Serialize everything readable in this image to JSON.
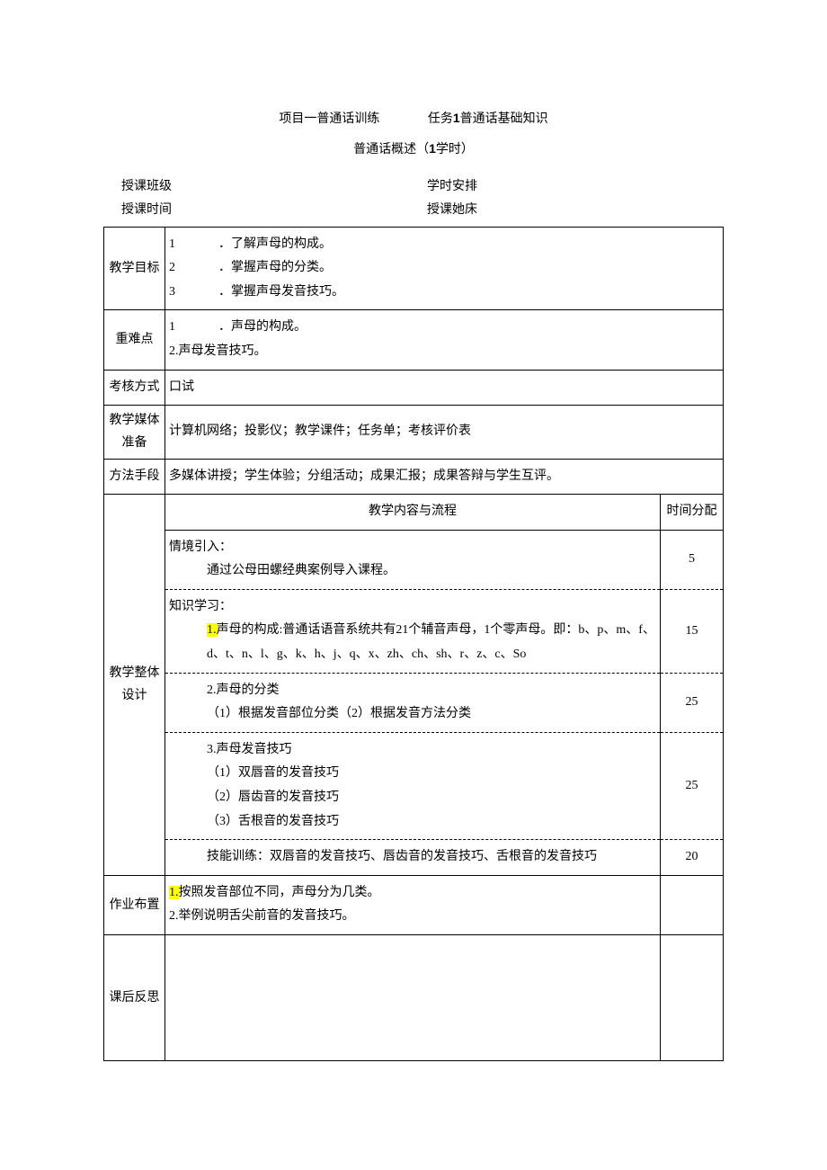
{
  "title": {
    "project": "项目一普通话训练",
    "task": "任务",
    "task_num": "1",
    "task_name": "普通话基础知识",
    "subtitle_pre": "普通话概述（",
    "subtitle_num": "1",
    "subtitle_post": "学时）"
  },
  "header": {
    "class_label": "授课班级",
    "class_value": "",
    "schedule_label": "学时安排",
    "schedule_value": "",
    "time_label": "授课时间",
    "time_value": "",
    "location_label": "授课她床",
    "location_value": ""
  },
  "rows": {
    "goal_label": "教学目标",
    "goals": {
      "n1": "1",
      "t1": "．了解声母的构成。",
      "n2": "2",
      "t2": "．掌握声母的分类。",
      "n3": "3",
      "t3": "．掌握声母发音技巧。"
    },
    "keypoint_label": "重难点",
    "keypoints": {
      "n1": "1",
      "t1": "．声母的构成。",
      "line2": "2.声母发音技巧。"
    },
    "assess_label": "考核方式",
    "assess_value": "口试",
    "media_label": "教学媒体准备",
    "media_value": "计算机网络；投影仪；教学课件；任务单；考核评价表",
    "method_label": "方法手段",
    "method_value": "多媒体讲授；学生体验；分组活动；成果汇报；成果答辩与学生互评。",
    "design_label": "教学整体设计",
    "content_header": "教学内容与流程",
    "time_header": "时间分配",
    "sections": [
      {
        "heading": "情境引入：",
        "body": "通过公母田螺经典案例导入课程。",
        "time": "5"
      },
      {
        "heading": "知识学习：",
        "body_hl": "1.",
        "body": "声母的构成:普通话语音系统共有21个辅音声母，1个零声母。即：b、p、m、f、d、t、n、l、g、k、h、j、q、x、zh、ch、sh、r、z、c、So",
        "time": "15"
      },
      {
        "line1": "2.声母的分类",
        "line2": "（1）根据发音部位分类（2）根据发音方法分类",
        "time": "25"
      },
      {
        "line1": "3.声母发音技巧",
        "line2": "（1）双唇音的发音技巧",
        "line3": "（2）唇齿音的发音技巧",
        "line4": "（3）舌根音的发音技巧",
        "time": "25"
      },
      {
        "body": "技能训练：双唇音的发音技巧、唇齿音的发音技巧、舌根音的发音技巧",
        "time": "20"
      }
    ],
    "homework_label": "作业布置",
    "homework": {
      "hl": "1.",
      "line1": "按照发音部位不同，声母分为几类。",
      "line2": "2.举例说明舌尖前音的发音技巧。"
    },
    "reflect_label": "课后反思",
    "reflect_value": ""
  }
}
